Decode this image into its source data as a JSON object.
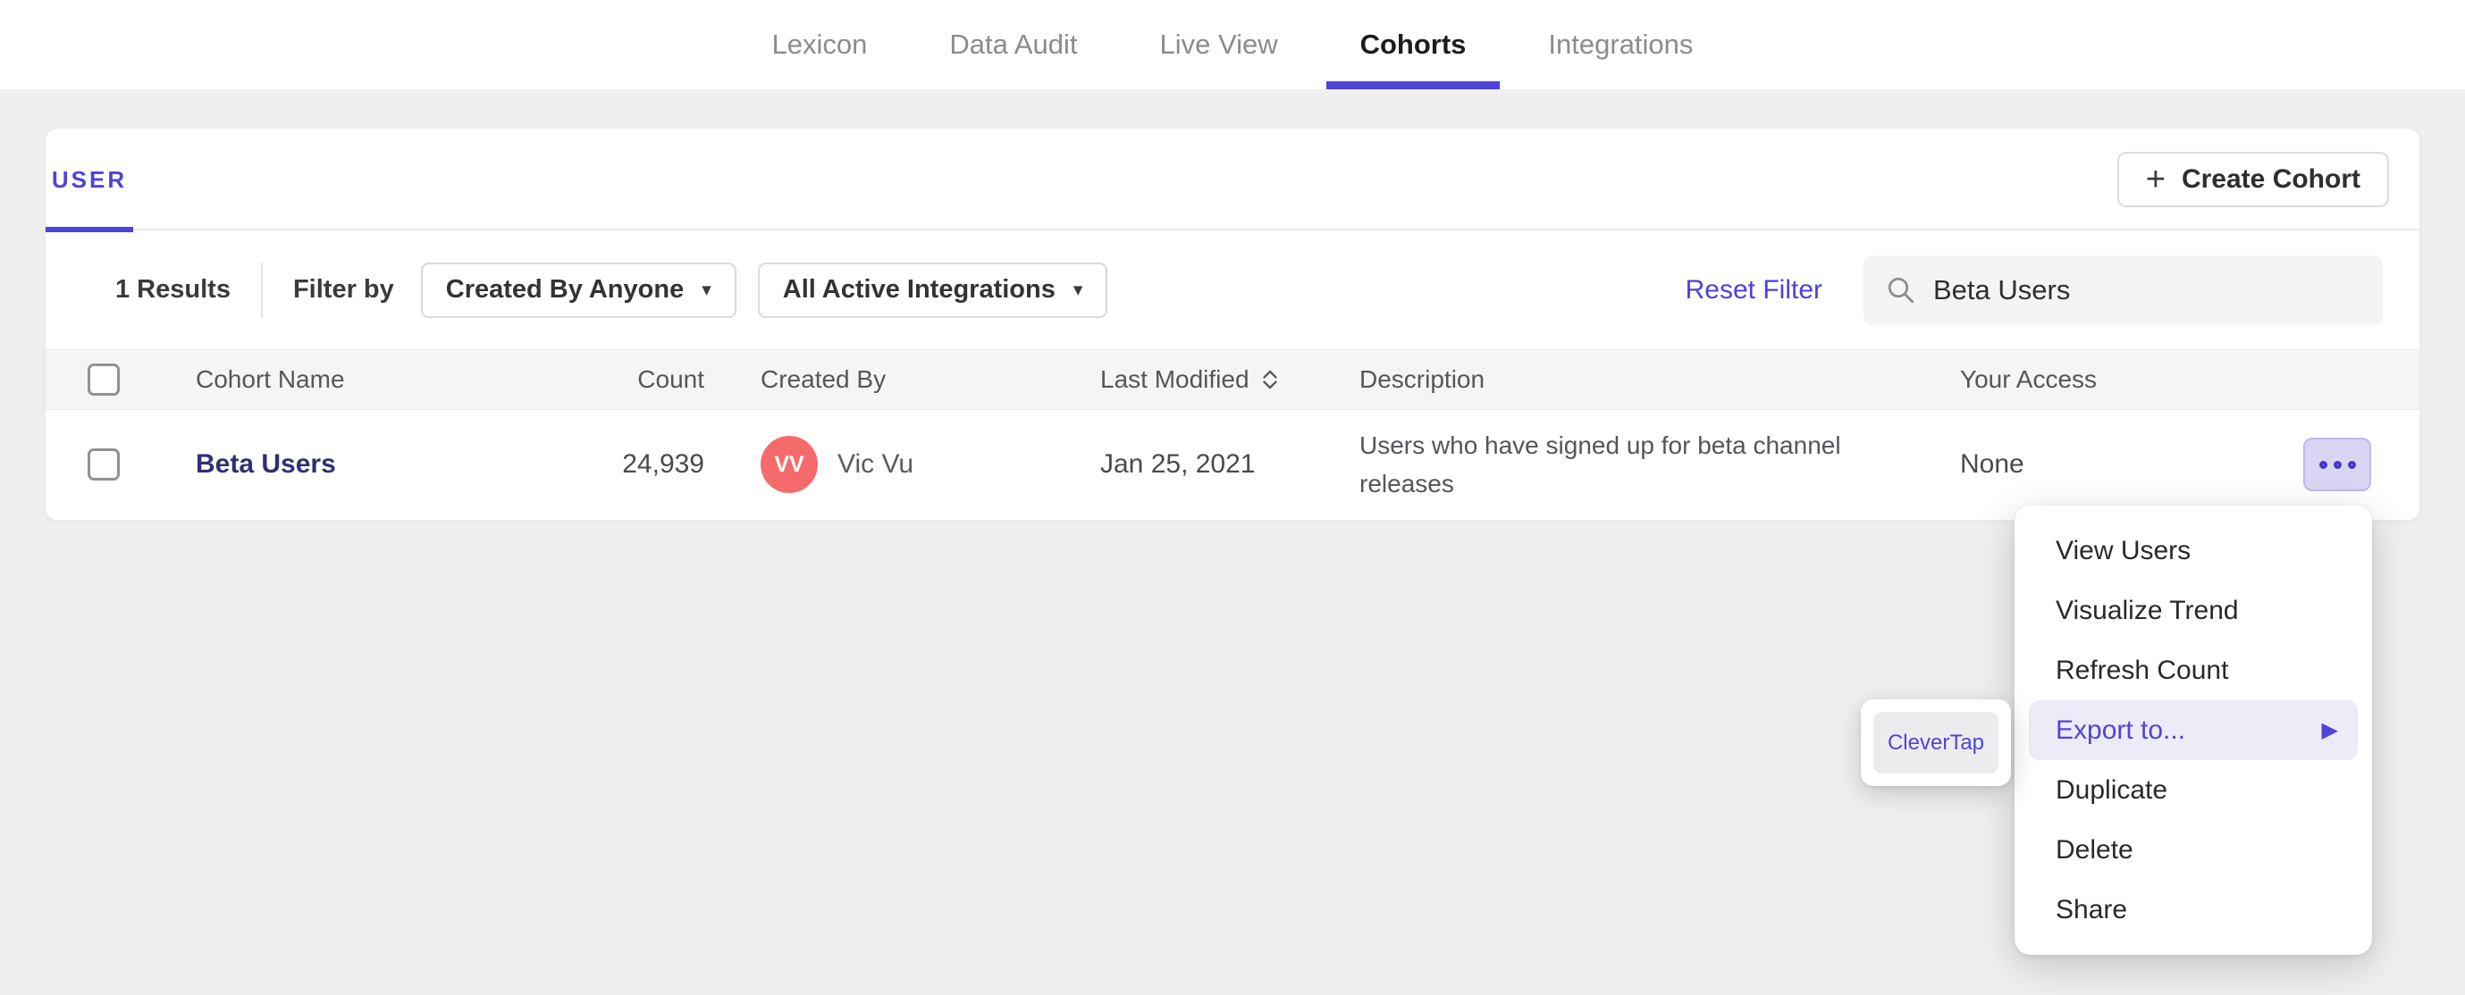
{
  "nav": {
    "items": [
      {
        "label": "Lexicon",
        "active": false
      },
      {
        "label": "Data Audit",
        "active": false
      },
      {
        "label": "Live View",
        "active": false
      },
      {
        "label": "Cohorts",
        "active": true
      },
      {
        "label": "Integrations",
        "active": false
      }
    ]
  },
  "panel": {
    "tab": {
      "label": "USER",
      "active": true
    },
    "create_button": {
      "label": "Create Cohort",
      "plus_icon": "+"
    },
    "toolbar": {
      "results_count": "1 Results",
      "filter_by_label": "Filter by",
      "created_by_dropdown": {
        "value": "Created By Anyone",
        "caret": "▾"
      },
      "integrations_dropdown": {
        "value": "All Active Integrations",
        "caret": "▾"
      },
      "reset_filter_label": "Reset Filter",
      "search": {
        "value": "Beta Users",
        "icon": "search-icon"
      }
    },
    "table": {
      "columns": {
        "name": "Cohort Name",
        "count": "Count",
        "created_by": "Created By",
        "last_modified": "Last Modified",
        "description": "Description",
        "your_access": "Your Access"
      },
      "sort_column": "Last Modified",
      "rows": [
        {
          "name": "Beta Users",
          "count": "24,939",
          "created_by_initials": "VV",
          "created_by_name": "Vic Vu",
          "last_modified": "Jan 25, 2021",
          "description": "Users who have signed up for beta channel releases",
          "your_access": "None",
          "actions_icon": "ellipsis"
        }
      ]
    }
  },
  "context_menu": {
    "items": [
      {
        "label": "View Users",
        "highlighted": false
      },
      {
        "label": "Visualize Trend",
        "highlighted": false
      },
      {
        "label": "Refresh Count",
        "highlighted": false
      },
      {
        "label": "Export to...",
        "highlighted": true,
        "has_submenu": true,
        "arrow": "▶"
      },
      {
        "label": "Duplicate",
        "highlighted": false
      },
      {
        "label": "Delete",
        "highlighted": false
      },
      {
        "label": "Share",
        "highlighted": false
      }
    ]
  },
  "export_submenu": {
    "items": [
      {
        "label": "CleverTap",
        "hovered": true
      }
    ]
  },
  "colors": {
    "accent_purple": "#4f44d8",
    "link_navy": "#322f75",
    "avatar_red": "#f56b6b",
    "menu_highlight": "#ecebf8",
    "page_background": "#efeff0",
    "ellipsis_button_bg": "#d9d6f3"
  }
}
